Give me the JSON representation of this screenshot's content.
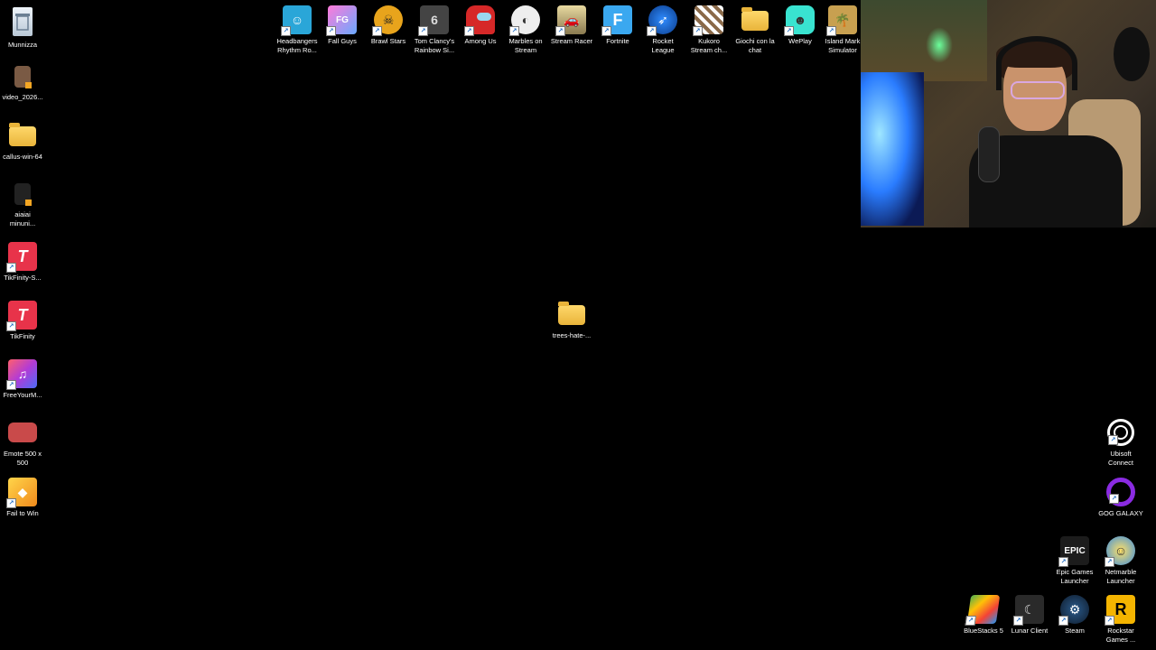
{
  "desktop": {
    "left_icons": [
      {
        "name": "recycle-bin-icon",
        "label": "Munnizza",
        "color": "#dfe8f0"
      },
      {
        "name": "video-file-icon",
        "label": "video_2026...",
        "color": "#7a5a44"
      },
      {
        "name": "folder-icon",
        "label": "callus-win-64",
        "color": "#f2c14e"
      },
      {
        "name": "video-file-icon",
        "label": "aiaiai\nminuni...",
        "color": "#333333"
      },
      {
        "name": "tikfinity-icon",
        "label": "TikFinity-S...",
        "color": "#e8334a"
      },
      {
        "name": "tikfinity-icon",
        "label": "TikFinity",
        "color": "#e8334a"
      },
      {
        "name": "freeyourmusic-icon",
        "label": "FreeYourM...",
        "color": "#b23bd6"
      },
      {
        "name": "image-file-icon",
        "label": "Emote 500 x\n500",
        "color": "#c94a4a"
      },
      {
        "name": "fail-to-win-icon",
        "label": "Fail to Win",
        "color": "#f0a020"
      }
    ],
    "top_icons": [
      {
        "name": "headbangers-icon",
        "label": "Headbangers\nRhythm Ro...",
        "color": "#2aa6d8"
      },
      {
        "name": "fall-guys-icon",
        "label": "Fall Guys",
        "color": "#7b6cf0"
      },
      {
        "name": "brawl-stars-icon",
        "label": "Brawl Stars",
        "color": "#e8a41c"
      },
      {
        "name": "rainbow-six-icon",
        "label": "Tom Clancy's\nRainbow Si...",
        "color": "#555555"
      },
      {
        "name": "among-us-icon",
        "label": "Among Us",
        "color": "#d62828"
      },
      {
        "name": "marbles-icon",
        "label": "Marbles on\nStream",
        "color": "#dddddd"
      },
      {
        "name": "stream-racer-icon",
        "label": "Stream Racer",
        "color": "#d9c27a"
      },
      {
        "name": "fortnite-icon",
        "label": "Fortnite",
        "color": "#3aa8f0"
      },
      {
        "name": "rocket-league-icon",
        "label": "Rocket\nLeague",
        "color": "#1c5fbf"
      },
      {
        "name": "kukoro-icon",
        "label": "Kukoro\nStream ch...",
        "color": "#b8b8b8"
      },
      {
        "name": "folder-icon",
        "label": "Giochi con la\nchat",
        "color": "#f2c14e"
      },
      {
        "name": "weplay-icon",
        "label": "WePlay",
        "color": "#39e3d0"
      },
      {
        "name": "island-market-icon",
        "label": "Island Mark\nSimulator",
        "color": "#c8a050"
      }
    ],
    "center_icon": {
      "name": "folder-icon",
      "label": "trees-hate-..."
    },
    "right_icons": [
      {
        "name": "ubisoft-connect-icon",
        "label": "Ubisoft\nConnect",
        "color": "#ffffff"
      },
      {
        "name": "gog-galaxy-icon",
        "label": "GOG GALAXY",
        "color": "#8a2be2"
      },
      {
        "name": "epic-games-icon",
        "label": "Epic Games\nLauncher",
        "color": "#222222"
      },
      {
        "name": "netmarble-icon",
        "label": "Netmarble\nLauncher",
        "color": "#f5c400"
      },
      {
        "name": "bluestacks-icon",
        "label": "BlueStacks 5",
        "color": "#4caf50"
      },
      {
        "name": "lunar-client-icon",
        "label": "Lunar Client",
        "color": "#333333"
      },
      {
        "name": "steam-icon",
        "label": "Steam",
        "color": "#1b2838"
      },
      {
        "name": "rockstar-icon",
        "label": "Rockstar\nGames ...",
        "color": "#f4b400"
      }
    ]
  }
}
